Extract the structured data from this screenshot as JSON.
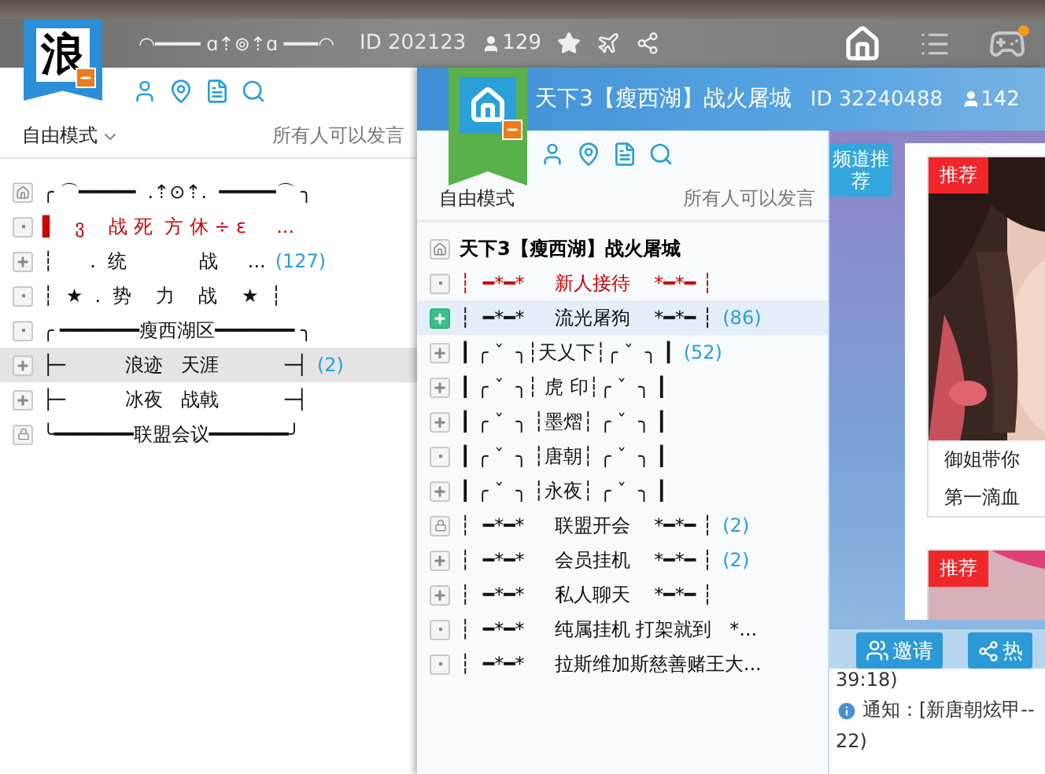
{
  "main_window": {
    "logo_char": "浪",
    "name": "◠━━━━ ɑ⇡⊚⇡ɑ ━━━◠",
    "id": "ID 202123",
    "members": "129",
    "nav": [
      {
        "kind": "home",
        "selected": true,
        "alert": false
      },
      {
        "kind": "list",
        "selected": false,
        "alert": false
      },
      {
        "kind": "games",
        "selected": false,
        "alert": true
      }
    ],
    "mode": "自由模式",
    "speak": "所有人可以发言",
    "channels": [
      {
        "kind": "home",
        "text": "╭ ⌒━━━━━  .⇡⊙⇡.  ━━━━━⌒ ╮",
        "selected": false,
        "color": "#111111"
      },
      {
        "kind": "dot",
        "text": "▌   ვ    战 死  方 休 ÷ ε     ...",
        "selected": false,
        "color": "#cc0000"
      },
      {
        "kind": "plus",
        "text": "┆      .  统            战     ...",
        "count": "(127)",
        "selected": false,
        "color": "#111111"
      },
      {
        "kind": "dot",
        "text": "┆  ★  .  势    力    战    ★  ┆",
        "selected": false,
        "color": "#111111"
      },
      {
        "kind": "dot",
        "text": "╭ ━━━━━━━瘦西湖区━━━━━━━ ╮",
        "selected": false,
        "color": "#111111"
      },
      {
        "kind": "plus",
        "text": "├─          浪迹   天涯           ─┤",
        "count": "(2)",
        "selected": true,
        "color": "#111111"
      },
      {
        "kind": "plus",
        "text": "├─          冰夜   战戟           ─┤",
        "selected": false,
        "color": "#111111"
      },
      {
        "kind": "lock",
        "text": "╰━━━━━━━联盟会议━━━━━━━╯",
        "selected": false,
        "color": "#111111"
      }
    ]
  },
  "room_window": {
    "title": "天下3【瘦西湖】战火屠城",
    "id": "ID 32240488",
    "members": "142",
    "mode": "自由模式",
    "speak": "所有人可以发言",
    "channels": [
      {
        "kind": "title",
        "text": "天下3【瘦西湖】战火屠城",
        "selected": false,
        "color": "#000000"
      },
      {
        "kind": "dot",
        "text": "┆  ━*━*     新人接待    *━*━ ┆",
        "selected": false,
        "color": "#cc0000"
      },
      {
        "kind": "plus",
        "text": "┆  ━*━*     流光屠狗    *━*━ ┆",
        "count": "(86)",
        "selected": true,
        "color": "#111111"
      },
      {
        "kind": "plus",
        "text": "┃ ╭ ˇ  ╮┆天乂下┆╭ ˇ  ╮ ┃",
        "count": "(52)",
        "selected": false,
        "color": "#111111"
      },
      {
        "kind": "plus",
        "text": "┃ ╭ ˇ  ╮┆ 虎 印┆╭ ˇ  ╮ ┃",
        "selected": false,
        "color": "#111111"
      },
      {
        "kind": "plus",
        "text": "┃ ╭ ˇ  ╮ ┆墨熠┆ ╭ ˇ  ╮ ┃",
        "selected": false,
        "color": "#111111"
      },
      {
        "kind": "dot",
        "text": "┃ ╭ ˇ  ╮ ┆唐朝┆ ╭ ˇ  ╮ ┃",
        "selected": false,
        "color": "#111111"
      },
      {
        "kind": "plus",
        "text": "┃ ╭ ˇ  ╮ ┆永夜┆ ╭ ˇ  ╮ ┃",
        "selected": false,
        "color": "#111111"
      },
      {
        "kind": "lock",
        "text": "┆  ━*━*     联盟开会    *━*━ ┆",
        "count": "(2)",
        "selected": false,
        "color": "#111111"
      },
      {
        "kind": "plus",
        "text": "┆  ━*━*     会员挂机    *━*━ ┆",
        "count": "(2)",
        "selected": false,
        "color": "#111111"
      },
      {
        "kind": "plus",
        "text": "┆  ━*━*     私人聊天    *━*━ ┆",
        "selected": false,
        "color": "#111111"
      },
      {
        "kind": "dot",
        "text": "┆  ━*━*     纯属挂机 打架就到   *...",
        "selected": false,
        "color": "#111111"
      },
      {
        "kind": "dot",
        "text": "┆  ━*━*     拉斯维加斯慈善赌王大...",
        "selected": false,
        "color": "#111111"
      }
    ],
    "recommend_tab": "频道推荐",
    "cards": [
      {
        "badge": "推荐",
        "lines": [
          "御姐带你",
          "第一滴血"
        ]
      },
      {
        "badge": "推荐"
      }
    ],
    "buttons": [
      {
        "label": "邀请",
        "kind": "invite"
      },
      {
        "label": "热",
        "kind": "hot"
      }
    ],
    "chat": [
      {
        "text": "39:18)",
        "kind": "plain"
      },
      {
        "text": "通知：[新唐朝炫甲--",
        "kind": "notice"
      },
      {
        "text": "22)",
        "kind": "plain"
      }
    ]
  }
}
